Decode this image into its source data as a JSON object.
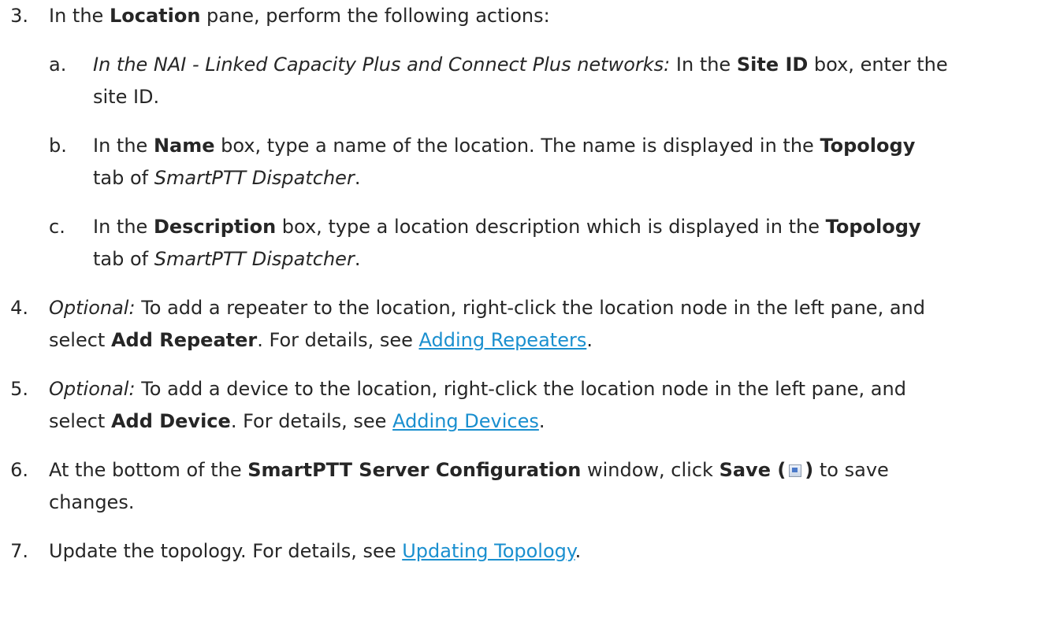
{
  "step3": {
    "num": "3.",
    "t1": "In the ",
    "b1": "Location",
    "t2": " pane, perform the following actions:"
  },
  "step3a": {
    "letter": "a.",
    "i1": "In the NAI - Linked Capacity Plus and Connect Plus networks:",
    "t1": " In the ",
    "b1": "Site ID",
    "t2": " box, enter the",
    "t3": "site ID."
  },
  "step3b": {
    "letter": "b.",
    "t1": "In the ",
    "b1": "Name",
    "t2": " box, type a name of the location. The name is displayed in the ",
    "b2": "Topology",
    "t3": "tab of ",
    "i1": "SmartPTT Dispatcher",
    "t4": "."
  },
  "step3c": {
    "letter": "c.",
    "t1": "In the ",
    "b1": "Description",
    "t2": " box, type a location description which is displayed in the ",
    "b2": "Topology",
    "t3": "tab of ",
    "i1": "SmartPTT Dispatcher",
    "t4": "."
  },
  "step4": {
    "num": "4.",
    "i1": "Optional:",
    "t1": " To add a repeater to the location, right-click the location node in the left pane, and",
    "t2": "select ",
    "b1": "Add Repeater",
    "t3": ". For details, see ",
    "link": "Adding Repeaters",
    "t4": "."
  },
  "step5": {
    "num": "5.",
    "i1": "Optional:",
    "t1": " To add a device to the location, right-click the location node in the left pane, and",
    "t2": "select ",
    "b1": "Add Device",
    "t3": ". For details, see ",
    "link": "Adding Devices",
    "t4": "."
  },
  "step6": {
    "num": "6.",
    "t1": "At the bottom of the ",
    "b1": "SmartPTT Server Configuration",
    "t2": " window, click ",
    "b2": "Save (",
    "icon": "save-icon",
    "b3": ")",
    "t3": " to save",
    "t4": "changes."
  },
  "step7": {
    "num": "7.",
    "t1": "Update the topology. For details, see ",
    "link": "Updating Topology",
    "t2": "."
  },
  "colors": {
    "text": "#262626",
    "link": "#1a8fcf",
    "background": "#ffffff"
  }
}
